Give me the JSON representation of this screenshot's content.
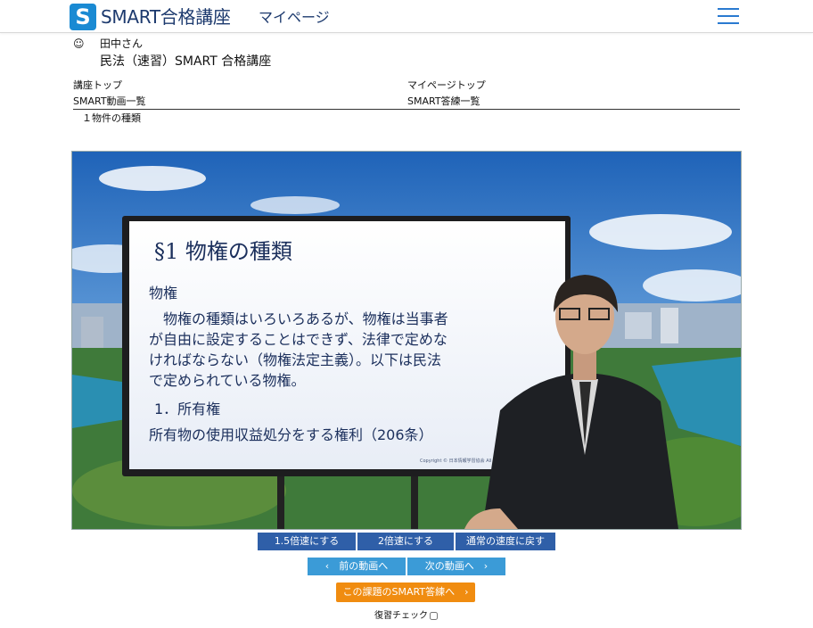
{
  "header": {
    "logo_letter": "S",
    "brand": "SMART合格講座",
    "subtitle": "マイページ"
  },
  "user": {
    "icon": "smiley-icon",
    "name": "田中さん",
    "course": "民法（速習）SMART 合格講座"
  },
  "nav": {
    "course_top": "講座トップ",
    "mypage_top": "マイページトップ",
    "video_list": "SMART動画一覧",
    "answer_list": "SMART答練一覧"
  },
  "lesson_title": "１物件の種類",
  "video": {
    "slide_heading": "§1  物権の種類",
    "slide_subheading": "物権",
    "slide_lines": [
      "　物権の種類はいろいろあるが、物権は当事者",
      "が自由に設定することはできず、法律で定めな",
      "ければならない（物権法定主義）。以下は民法",
      "で定められている物権。"
    ],
    "slide_item": "1．所有権",
    "slide_item_desc": "所有物の使用収益処分をする権利（206条）",
    "slide_copyright": "Copyright © 日本情報学習協会 All Rights Reserved"
  },
  "speed_buttons": {
    "x15": "1.5倍速にする",
    "x2": "2倍速にする",
    "normal": "通常の速度に戻す"
  },
  "nav_buttons": {
    "prev": "前の動画へ",
    "next": "次の動画へ",
    "prev_icon": "chevron-left-icon",
    "next_icon": "chevron-right-icon"
  },
  "smart_answer_button": "この課題のSMART答練へ",
  "review_check_label": "復習チェック",
  "colors": {
    "brand": "#1d3a6e",
    "logo": "#1a8ad3",
    "speed_btn": "#2f5fa8",
    "nav_btn": "#3b9bd7",
    "cta": "#f08c10"
  }
}
